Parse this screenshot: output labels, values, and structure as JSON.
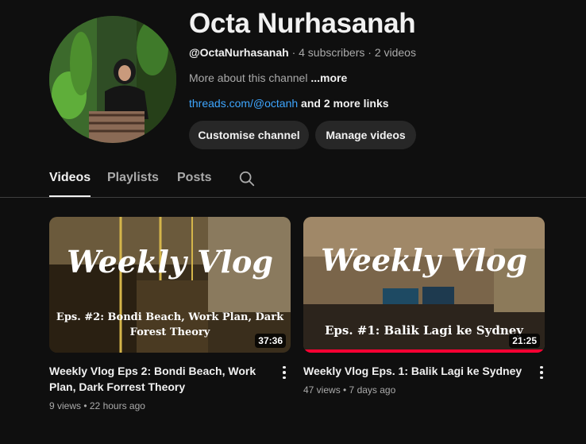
{
  "channel": {
    "name": "Octa Nurhasanah",
    "handle": "@OctaNurhasanah",
    "stats": " · 4 subscribers · 2 videos",
    "about_prefix": "More about this channel ",
    "about_more": "...more",
    "link": "threads.com/@octanh",
    "more_links": " and 2 more links"
  },
  "buttons": {
    "customise": "Customise channel",
    "manage": "Manage videos"
  },
  "tabs": [
    {
      "label": "Videos",
      "active": true
    },
    {
      "label": "Playlists",
      "active": false
    },
    {
      "label": "Posts",
      "active": false
    }
  ],
  "videos": [
    {
      "title": "Weekly Vlog Eps 2: Bondi Beach, Work Plan, Dark Forrest Theory",
      "meta": "9 views • 22 hours ago",
      "duration": "37:36",
      "thumb_title": "Weekly Vlog",
      "thumb_subtitle_1": "Eps. #2: Bondi Beach, Work Plan, Dark",
      "thumb_subtitle_2": "Forest Theory",
      "watched_progress": 0
    },
    {
      "title": "Weekly Vlog Eps. 1: Balik Lagi ke Sydney",
      "meta": "47 views • 7 days ago",
      "duration": "21:25",
      "thumb_title": "Weekly Vlog",
      "thumb_subtitle_1": "Eps. #1: Balik Lagi ke Sydney",
      "watched_progress": 1.0
    }
  ],
  "colors": {
    "background": "#0f0f0f",
    "link": "#3ea6ff",
    "progress": "#ff0033"
  }
}
